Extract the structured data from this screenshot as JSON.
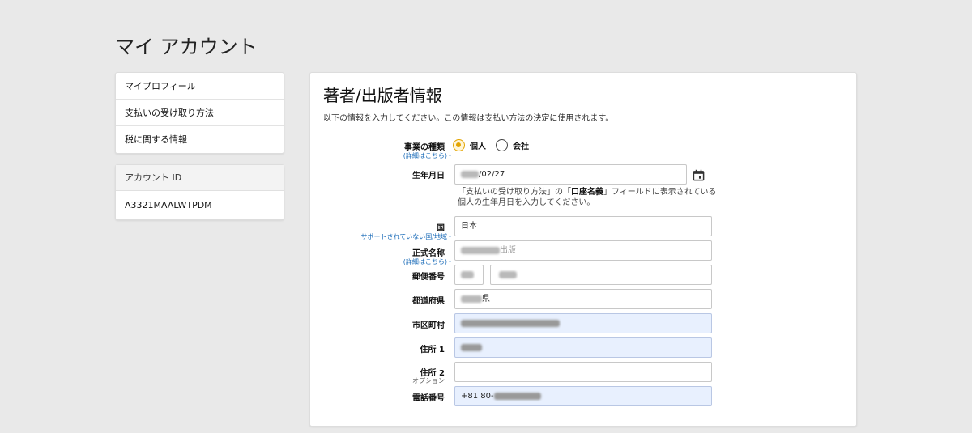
{
  "header": {
    "title": "マイ アカウント"
  },
  "sidebar": {
    "items": [
      {
        "label": "マイプロフィール"
      },
      {
        "label": "支払いの受け取り方法"
      },
      {
        "label": "税に関する情報"
      }
    ],
    "account": {
      "heading": "アカウント ID",
      "id": "A3321MAALWTPDM"
    }
  },
  "main": {
    "title": "著者/出版者情報",
    "description": "以下の情報を入力してください。この情報は支払い方法の決定に使用されます。",
    "business_type": {
      "label": "事業の種類",
      "details_link": "(詳細はこちら)",
      "options": [
        {
          "label": "個人",
          "checked": true
        },
        {
          "label": "会社",
          "checked": false
        }
      ]
    },
    "birthdate": {
      "label": "生年月日",
      "value_suffix": "/02/27",
      "helper_pre": "「支払いの受け取り方法」の「",
      "helper_bold": "口座名義",
      "helper_post": "」フィールドに表示されている個人の生年月日を入力してください。"
    },
    "country": {
      "label": "国",
      "link": "サポートされていない国/地域",
      "value": "日本"
    },
    "legal_name": {
      "label": "正式名称",
      "link": "(詳細はこちら)",
      "value_suffix": "出版"
    },
    "postal_code": {
      "label": "郵便番号"
    },
    "prefecture": {
      "label": "都道府県",
      "value_suffix": "県"
    },
    "city": {
      "label": "市区町村"
    },
    "address1": {
      "label": "住所 1"
    },
    "address2": {
      "label": "住所 2",
      "note": "オプション",
      "value": ""
    },
    "phone": {
      "label": "電話番号",
      "value_prefix": "+81 80-"
    }
  },
  "colors": {
    "background": "#e9e9e9",
    "accent": "#e3a400",
    "link": "#1a6bb8",
    "autofill": "#e8f0fe"
  },
  "icons": {
    "calendar": "calendar-icon",
    "caret": "caret-down-icon"
  }
}
